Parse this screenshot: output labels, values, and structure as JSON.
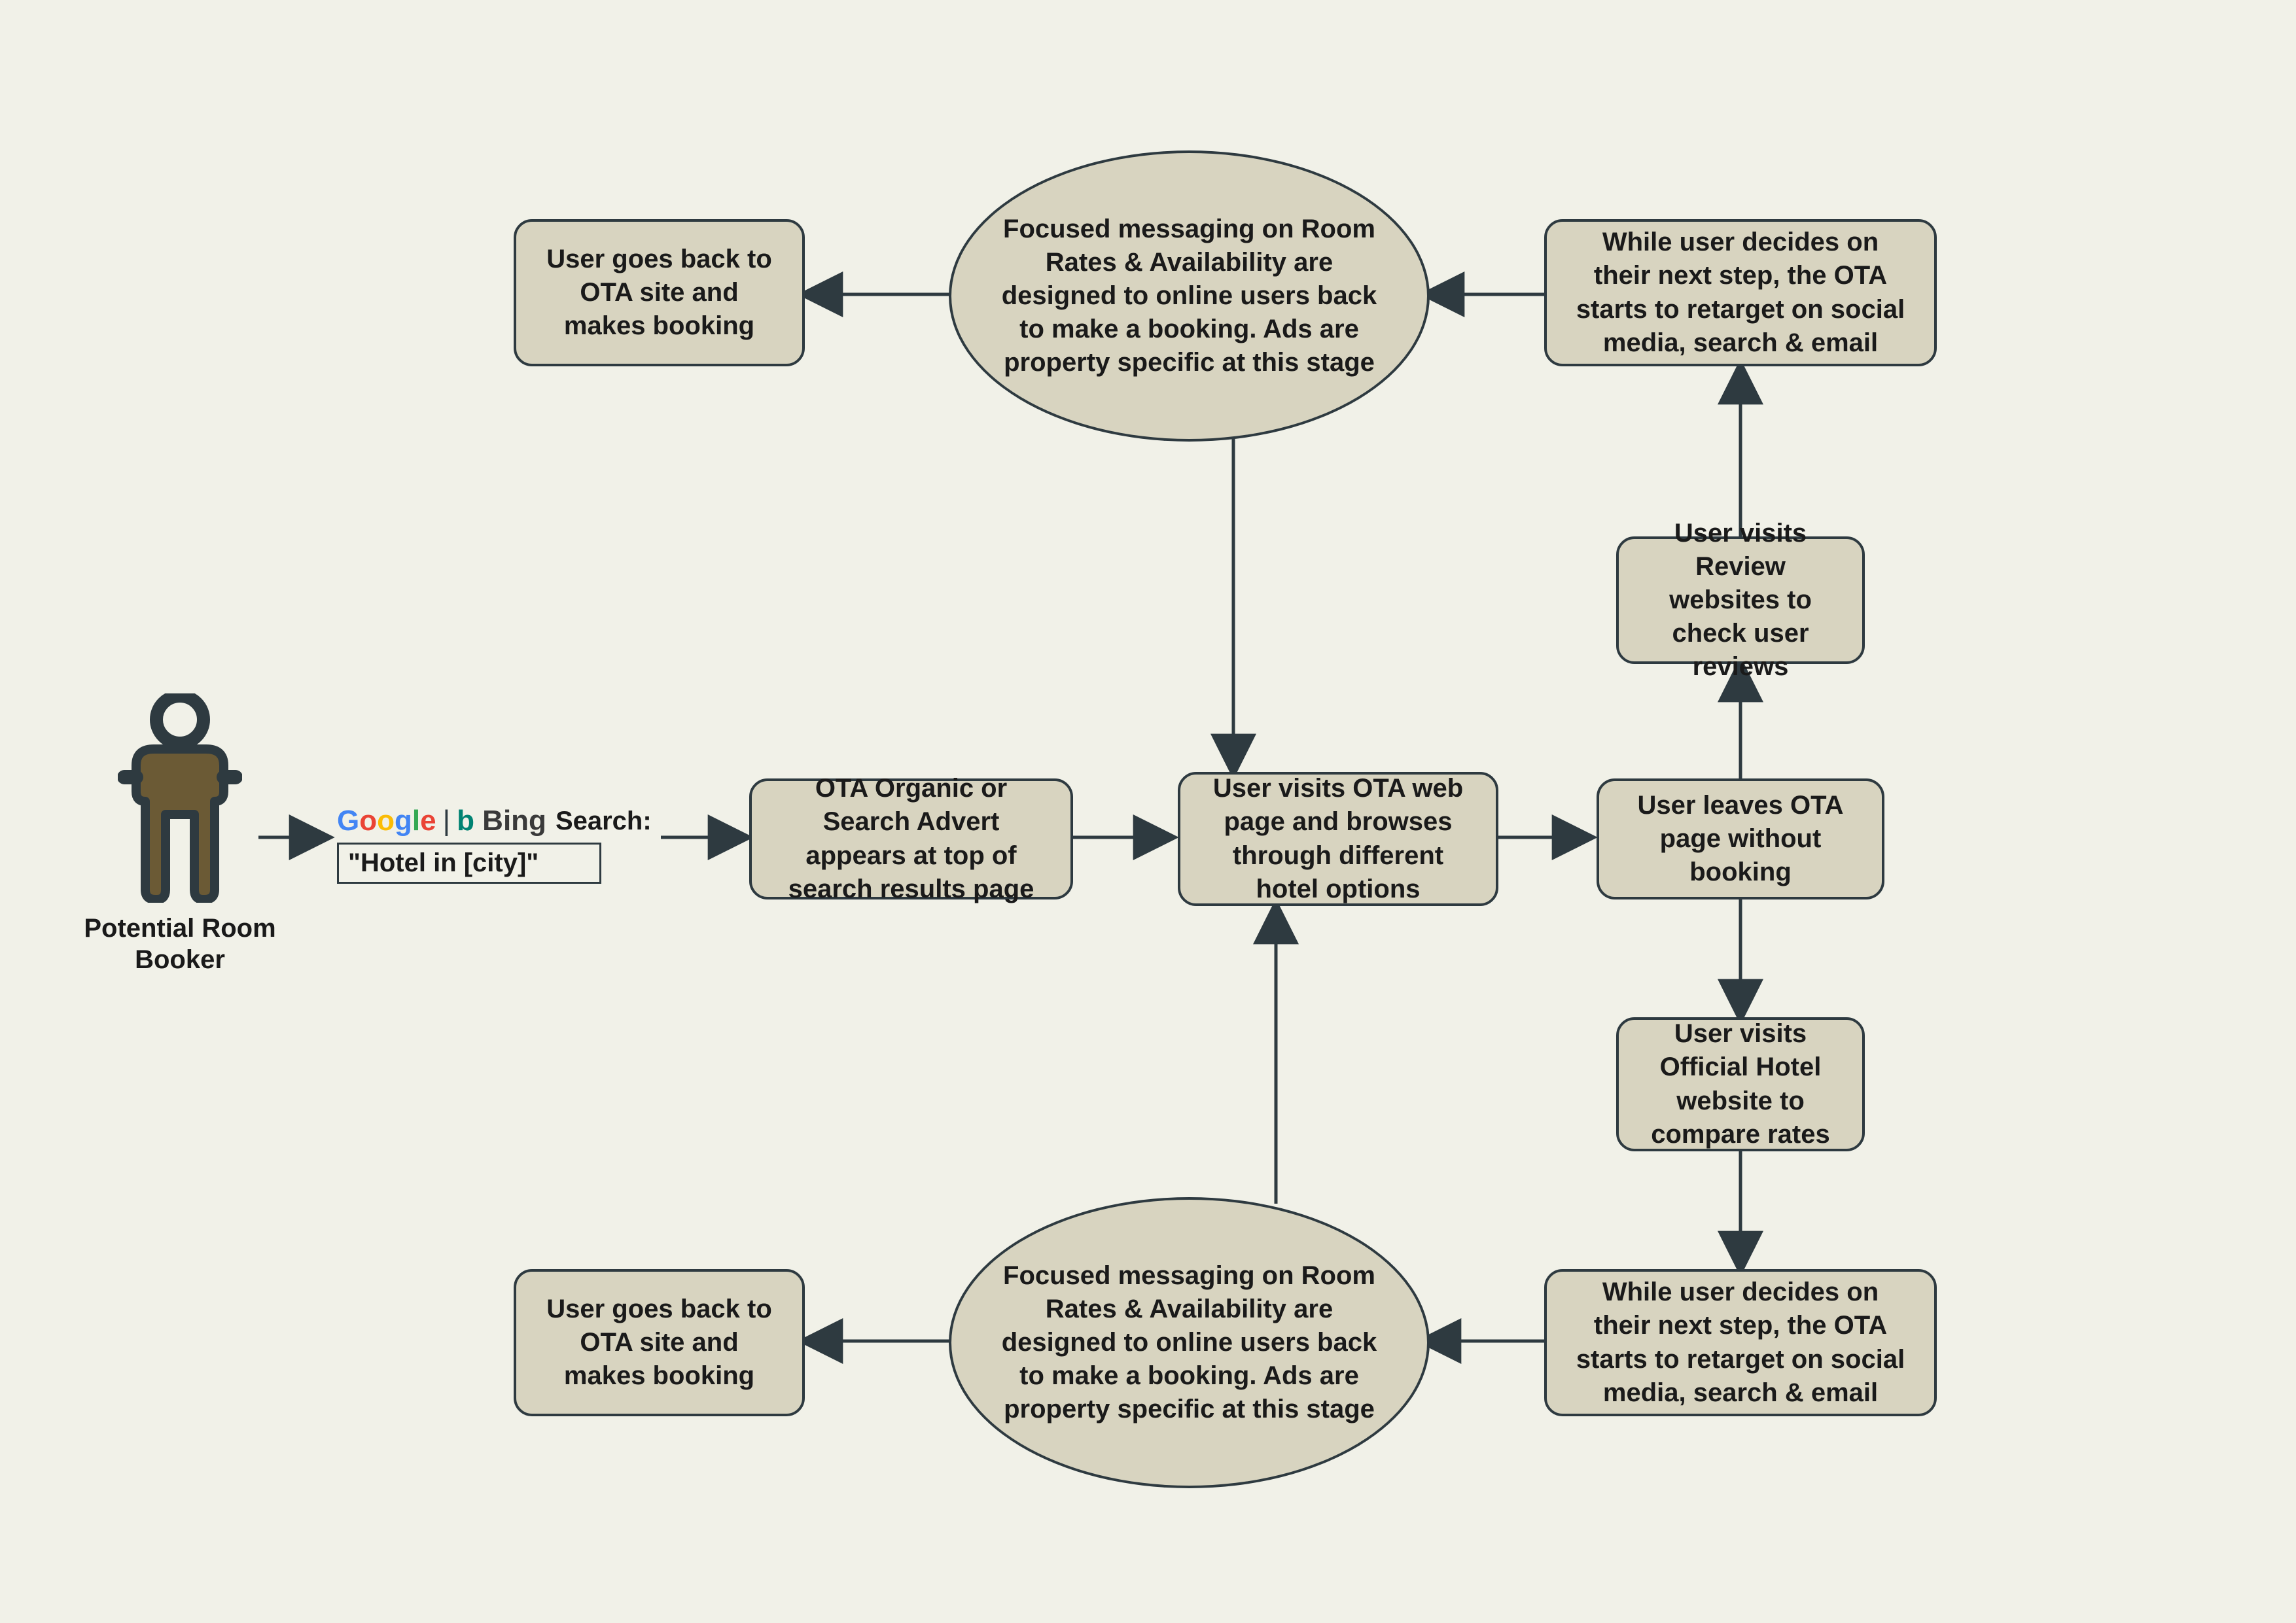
{
  "actor": {
    "label": "Potential Room Booker"
  },
  "search": {
    "label": "Search:",
    "query": "\"Hotel in [city]\"",
    "engines": {
      "google": "Google",
      "bing": "Bing"
    }
  },
  "nodes": {
    "ota_ad": "OTA Organic or Search Advert appears at top of search results page",
    "user_visits_ota": "User visits OTA web page and browses through different hotel options",
    "user_leaves": "User leaves OTA page without booking",
    "user_reviews": "User visits Review websites to check user reviews",
    "ota_retarget_top": "While user decides on their next step, the OTA starts to retarget on social media, search & email",
    "focused_msg_top": "Focused messaging on Room Rates & Availability are designed to online users back to make a booking. Ads are property specific at this stage",
    "user_books_top": "User goes back to OTA site and makes booking",
    "user_official": "User visits Official Hotel website to compare rates",
    "ota_retarget_bot": "While user decides on their next step, the OTA starts to retarget on social media, search & email",
    "focused_msg_bot": "Focused messaging on Room Rates & Availability are designed to online users back to make a booking. Ads are property specific at this stage",
    "user_books_bot": "User goes back to OTA site and makes booking"
  }
}
